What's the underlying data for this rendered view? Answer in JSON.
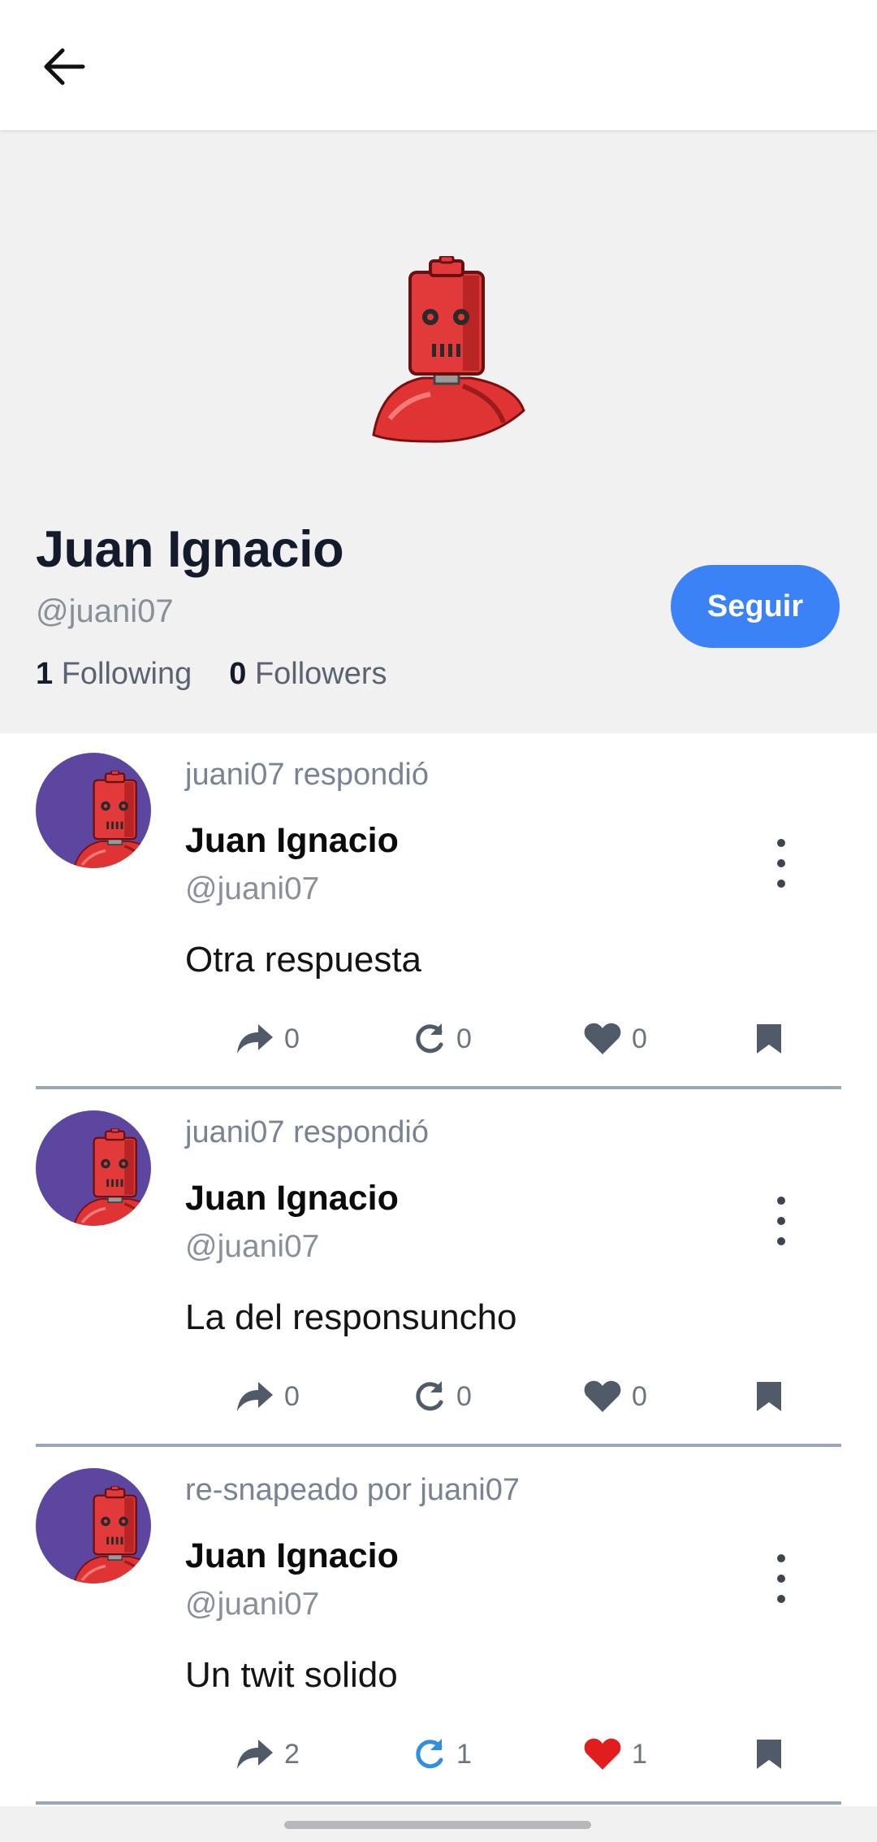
{
  "topbar": {
    "back_icon": "arrow-left-icon"
  },
  "profile": {
    "name": "Juan Ignacio",
    "handle": "@juani07",
    "following_count": "1",
    "following_label": "Following",
    "followers_count": "0",
    "followers_label": "Followers",
    "follow_button": "Seguir",
    "avatar_icon": "red-robot-avatar"
  },
  "colors": {
    "accent": "#3b82f6",
    "avatar_bg": "#5d46a0",
    "liked": "#e11d1d",
    "resnapped": "#2f8fe0",
    "header_bg": "#f1f1f2"
  },
  "posts": [
    {
      "meta": "juani07 respondió",
      "name": "Juan Ignacio",
      "handle": "@juani07",
      "text": "Otra respuesta",
      "replies": "0",
      "resnaps": "0",
      "likes": "0",
      "liked": false,
      "resnapped": false
    },
    {
      "meta": "juani07 respondió",
      "name": "Juan Ignacio",
      "handle": "@juani07",
      "text": "La del responsuncho",
      "replies": "0",
      "resnaps": "0",
      "likes": "0",
      "liked": false,
      "resnapped": false
    },
    {
      "meta": "re-snapeado por juani07",
      "name": "Juan Ignacio",
      "handle": "@juani07",
      "text": "Un twit solido",
      "replies": "2",
      "resnaps": "1",
      "likes": "1",
      "liked": true,
      "resnapped": true
    }
  ]
}
